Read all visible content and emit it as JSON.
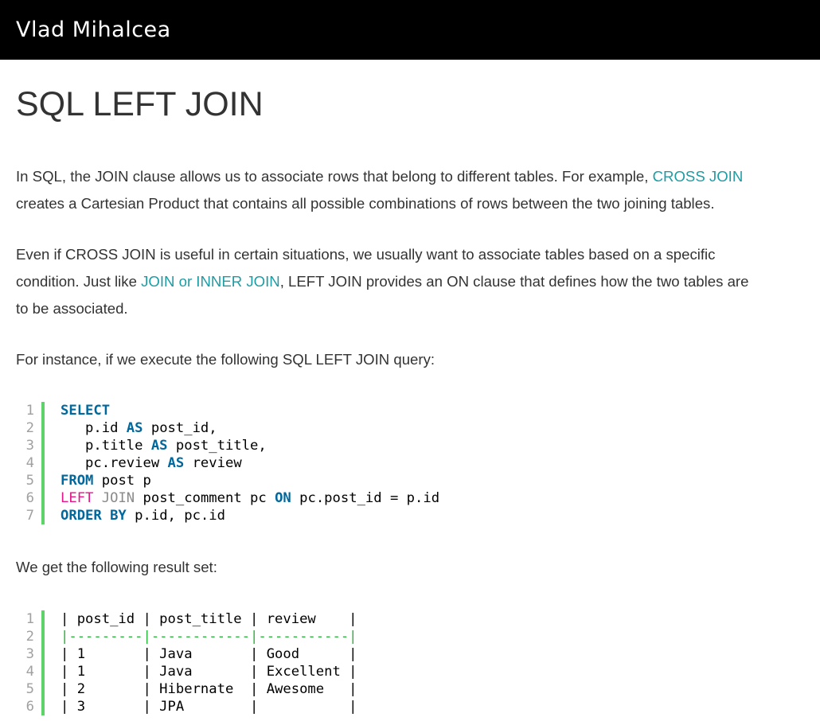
{
  "header": {
    "site_title": "Vlad Mihalcea"
  },
  "article": {
    "title": "SQL LEFT JOIN",
    "p1": {
      "text_a": "In SQL, the JOIN clause allows us to associate rows that belong to different tables. For example, ",
      "link": "CROSS JOIN",
      "text_b": "creates a Cartesian Product that contains all possible combinations of rows between the two joining tables."
    },
    "p2": {
      "text_a": "Even if CROSS JOIN is useful in certain situations, we usually want to associate tables based on a specific",
      "text_b": "condition. Just like ",
      "link": "JOIN or INNER JOIN",
      "text_c": ", LEFT JOIN provides an ON clause that defines how the two tables are",
      "text_d": "to be associated."
    },
    "p3": "For instance, if we execute the following SQL LEFT JOIN query:",
    "p4": "We get the following result set:"
  },
  "query_block": {
    "line_numbers": [
      "1",
      "2",
      "3",
      "4",
      "5",
      "6",
      "7"
    ],
    "lines": [
      {
        "kw": "SELECT"
      },
      {
        "a": "   p.id ",
        "kw": "AS",
        "b": " post_id,"
      },
      {
        "a": "   p.title ",
        "kw": "AS",
        "b": " post_title,"
      },
      {
        "a": "   pc.review ",
        "kw": "AS",
        "b": " review"
      },
      {
        "kw": "FROM",
        "b": " post p"
      },
      {
        "kw2a": "LEFT",
        "kw2b": " JOIN",
        "b": " post_comment pc ",
        "kw": "ON",
        "c": " pc.post_id = p.id"
      },
      {
        "kw": "ORDER BY",
        "b": " p.id, pc.id"
      }
    ]
  },
  "result_block": {
    "line_numbers": [
      "1",
      "2",
      "3",
      "4",
      "5",
      "6"
    ],
    "lines": [
      "| post_id | post_title | review    |",
      "|---------|------------|-----------|",
      "| 1       | Java       | Good      |",
      "| 1       | Java       | Excellent |",
      "| 2       | Hibernate  | Awesome   |",
      "| 3       | JPA        |           |"
    ]
  },
  "colors": {
    "header_bg": "#000000",
    "link": "#1e9ca4",
    "keyword": "#00689d",
    "keyword_alt": "#e1178c",
    "gutter_bar": "#5dd36a"
  }
}
